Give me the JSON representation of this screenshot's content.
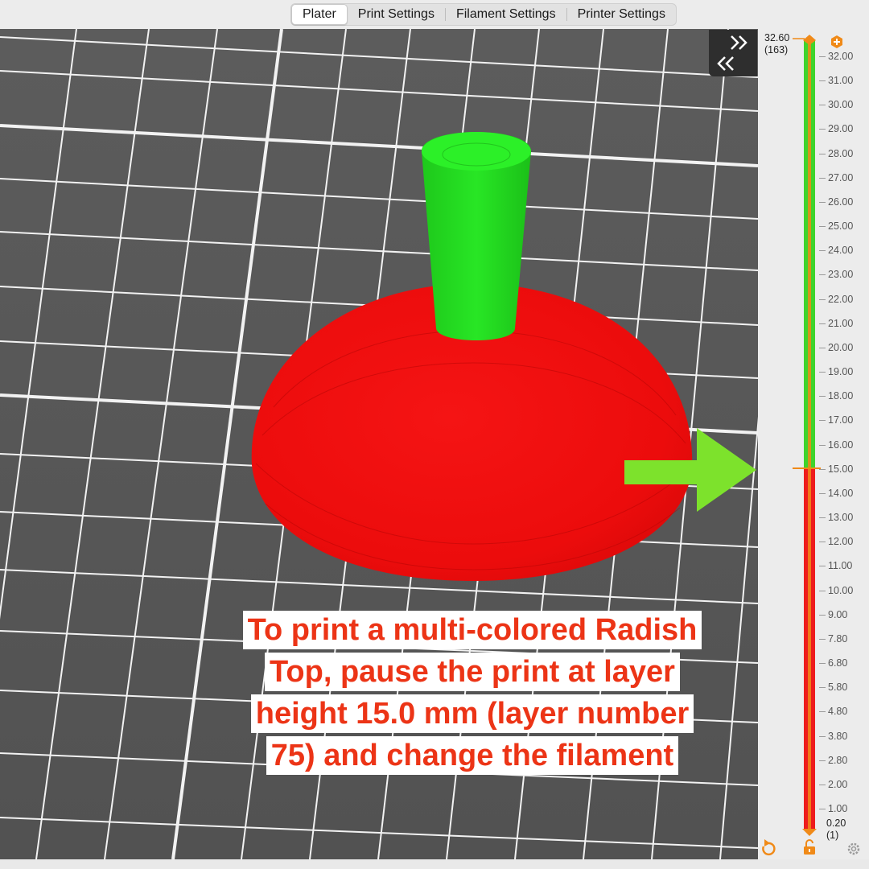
{
  "tabs": [
    {
      "label": "Plater",
      "active": true
    },
    {
      "label": "Print Settings",
      "active": false
    },
    {
      "label": "Filament Settings",
      "active": false
    },
    {
      "label": "Printer Settings",
      "active": false
    }
  ],
  "layer_slider": {
    "top_value": "32.60",
    "top_layer": "(163)",
    "bottom_value": "0.20",
    "bottom_layer": "(1)",
    "color_change_height_mm": 15.0,
    "upper_color": "#3fd42c",
    "lower_color": "#ee1c1c",
    "ticks": [
      "32.00",
      "31.00",
      "30.00",
      "29.00",
      "28.00",
      "27.00",
      "26.00",
      "25.00",
      "24.00",
      "23.00",
      "22.00",
      "21.00",
      "20.00",
      "19.00",
      "18.00",
      "17.00",
      "16.00",
      "15.00",
      "14.00",
      "13.00",
      "12.00",
      "11.00",
      "10.00",
      "9.00",
      "7.80",
      "6.80",
      "5.80",
      "4.80",
      "3.80",
      "2.80",
      "2.00",
      "1.00"
    ]
  },
  "icons": {
    "collapse": "collapse-sidebar-icon",
    "add_color_change": "plus-icon",
    "undo": "undo-icon",
    "lock": "unlock-icon",
    "settings": "gear-icon"
  },
  "caption": {
    "lines": [
      "To print a multi-colored Radish",
      "Top, pause the print at layer",
      "height 15.0 mm (layer number",
      "75) and change the filament"
    ],
    "color": "#ec3416"
  },
  "colors": {
    "model_top": "#22e01f",
    "model_bottom": "#f20c0c",
    "arrow": "#7de22c",
    "accent": "#f08a18"
  }
}
